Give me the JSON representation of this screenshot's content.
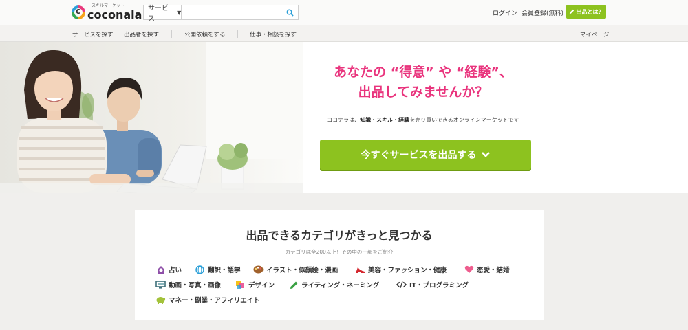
{
  "header": {
    "logo_sub": "スキルマーケット",
    "logo_main": "coconala",
    "search_category": "サービス",
    "search_placeholder": "",
    "login": "ログイン",
    "register": "会員登録(無料)",
    "sell_button": "出品とは？"
  },
  "nav": {
    "items": [
      "サービスを探す",
      "出品者を探す",
      "公開依頼をする",
      "仕事・相談を探す"
    ],
    "mypage": "マイページ"
  },
  "hero": {
    "title_line1": "あなたの “得意” や “経験”、",
    "title_line2": "出品してみませんか？",
    "sub_prefix": "ココナラは、",
    "sub_bold": "知識・スキル・経験",
    "sub_suffix": "を売り買いできるオンラインマーケットです",
    "cta": "今すぐサービスを出品する"
  },
  "categories": {
    "title": "出品できるカテゴリがきっと見つかる",
    "subtitle": "カテゴリは全200以上！その中の一部をご紹介",
    "items": [
      {
        "label": "占い",
        "icon": "fortune-icon",
        "color": "#8e4fa8"
      },
      {
        "label": "翻訳・語学",
        "icon": "globe-icon",
        "color": "#2a9fd8"
      },
      {
        "label": "イラスト・似顔絵・漫画",
        "icon": "palette-icon",
        "color": "#a0612c"
      },
      {
        "label": "美容・ファッション・健康",
        "icon": "heel-icon",
        "color": "#d4282f"
      },
      {
        "label": "恋愛・結婚",
        "icon": "heart-icon",
        "color": "#ee5d8e"
      },
      {
        "label": "動画・写真・画像",
        "icon": "monitor-icon",
        "color": "#3f6f7a"
      },
      {
        "label": "デザイン",
        "icon": "design-icon",
        "color": "#e94f91"
      },
      {
        "label": "ライティング・ネーミング",
        "icon": "pen-icon",
        "color": "#3aa043"
      },
      {
        "label": "IT・プログラミング",
        "icon": "code-icon",
        "color": "#333333"
      },
      {
        "label": "マネー・副業・アフィリエイト",
        "icon": "piggy-icon",
        "color": "#a3c23a"
      }
    ]
  },
  "colors": {
    "brand_green": "#8dc21f",
    "headline_pink": "#e9347d"
  }
}
